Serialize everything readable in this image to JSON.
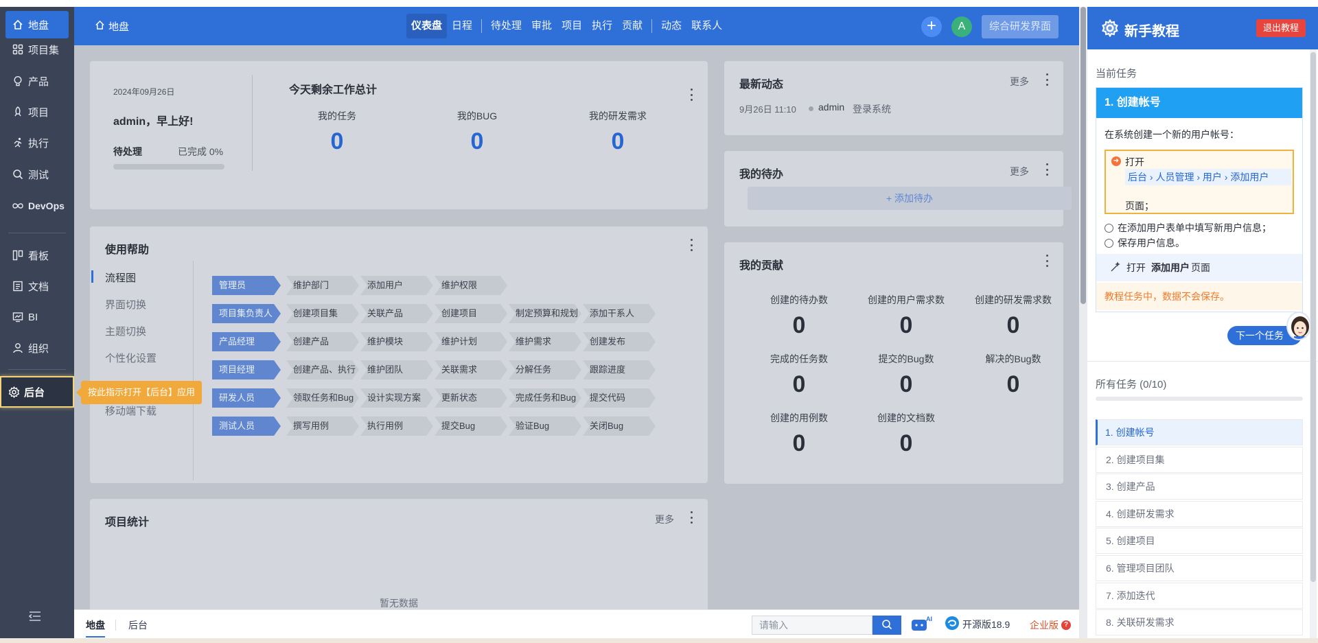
{
  "sidebar": {
    "items": [
      {
        "label": "地盘",
        "icon": "home-icon"
      },
      {
        "label": "项目集",
        "icon": "grid-icon"
      },
      {
        "label": "产品",
        "icon": "bulb-icon"
      },
      {
        "label": "项目",
        "icon": "rocket-icon"
      },
      {
        "label": "执行",
        "icon": "run-icon"
      },
      {
        "label": "测试",
        "icon": "search-icon"
      },
      {
        "label": "DevOps",
        "icon": "infinity-icon"
      },
      {
        "label": "看板",
        "icon": "kanban-icon"
      },
      {
        "label": "文档",
        "icon": "doc-icon"
      },
      {
        "label": "BI",
        "icon": "chart-icon"
      },
      {
        "label": "组织",
        "icon": "user-icon"
      },
      {
        "label": "后台",
        "icon": "gear-icon"
      }
    ]
  },
  "topbar": {
    "home": "地盘",
    "tabs": [
      "仪表盘",
      "日程",
      "待处理",
      "审批",
      "项目",
      "执行",
      "贡献",
      "动态",
      "联系人"
    ],
    "avatar": "A",
    "ui_switch": "综合研发界面"
  },
  "welcome": {
    "date": "2024年09月26日",
    "greeting": "admin，早上好!",
    "pending": "待处理",
    "done": "已完成 0%",
    "progress": 0,
    "remain_title": "今天剩余工作总计",
    "stats": [
      {
        "label": "我的任务",
        "value": "0"
      },
      {
        "label": "我的BUG",
        "value": "0"
      },
      {
        "label": "我的研发需求",
        "value": "0"
      }
    ]
  },
  "help": {
    "title": "使用帮助",
    "nav": [
      "流程图",
      "界面切换",
      "主题切换",
      "个性化设置",
      "移动端下载"
    ],
    "rows": [
      [
        "管理员",
        "维护部门",
        "添加用户",
        "维护权限"
      ],
      [
        "项目集负责人",
        "创建项目集",
        "关联产品",
        "创建项目",
        "制定预算和规划",
        "添加干系人"
      ],
      [
        "产品经理",
        "创建产品",
        "维护模块",
        "维护计划",
        "维护需求",
        "创建发布"
      ],
      [
        "项目经理",
        "创建产品、执行",
        "维护团队",
        "关联需求",
        "分解任务",
        "跟踪进度"
      ],
      [
        "研发人员",
        "领取任务和Bug",
        "设计实现方案",
        "更新状态",
        "完成任务和Bug",
        "提交代码"
      ],
      [
        "测试人员",
        "撰写用例",
        "执行用例",
        "提交Bug",
        "验证Bug",
        "关闭Bug"
      ]
    ]
  },
  "project_stats": {
    "title": "项目统计",
    "more": "更多",
    "empty": "暂无数据"
  },
  "dynamics": {
    "title": "最新动态",
    "more": "更多",
    "time": "9月26日 11:10",
    "user": "admin",
    "action": "登录系统"
  },
  "todo": {
    "title": "我的待办",
    "more": "更多",
    "add": "添加待办"
  },
  "contribution": {
    "title": "我的贡献",
    "items": [
      {
        "label": "创建的待办数",
        "value": "0"
      },
      {
        "label": "创建的用户需求数",
        "value": "0"
      },
      {
        "label": "创建的研发需求数",
        "value": "0"
      },
      {
        "label": "完成的任务数",
        "value": "0"
      },
      {
        "label": "提交的Bug数",
        "value": "0"
      },
      {
        "label": "解决的Bug数",
        "value": "0"
      },
      {
        "label": "创建的用例数",
        "value": "0"
      },
      {
        "label": "创建的文档数",
        "value": "0"
      }
    ]
  },
  "bottombar": {
    "tabs": [
      "地盘",
      "后台"
    ],
    "search_placeholder": "请输入",
    "ai": "AI",
    "version": "开源版18.9",
    "edition": "企业版",
    "edition_badge": "?"
  },
  "tooltip": "按此指示打开【后台】应用",
  "tutorial": {
    "title": "新手教程",
    "exit": "退出教程",
    "current_label": "当前任务",
    "task_title": "1. 创建帐号",
    "task_desc": "在系统创建一个新的用户帐号：",
    "step1_open": "打开",
    "step1_path": "后台 › 人员管理 › 用户 › 添加用户",
    "step1_page": "页面；",
    "step2": "在添加用户表单中填写新用户信息；",
    "step3": "保存用户信息。",
    "hint_prefix": "打开",
    "hint_target": "添加用户",
    "hint_suffix": "页面",
    "warn": "教程任务中，数据不会保存。",
    "next": "下一个任务",
    "all_label": "所有任务 (0/10)",
    "all_progress": 0,
    "tasks": [
      "1. 创建帐号",
      "2. 创建项目集",
      "3. 创建产品",
      "4. 创建研发需求",
      "5. 创建项目",
      "6. 管理项目团队",
      "7. 添加迭代",
      "8. 关联研发需求"
    ]
  },
  "colors": {
    "primary": "#2f6fd8",
    "warning": "#f2a93b",
    "danger": "#e8443e",
    "task_header": "#1fa0f2"
  }
}
